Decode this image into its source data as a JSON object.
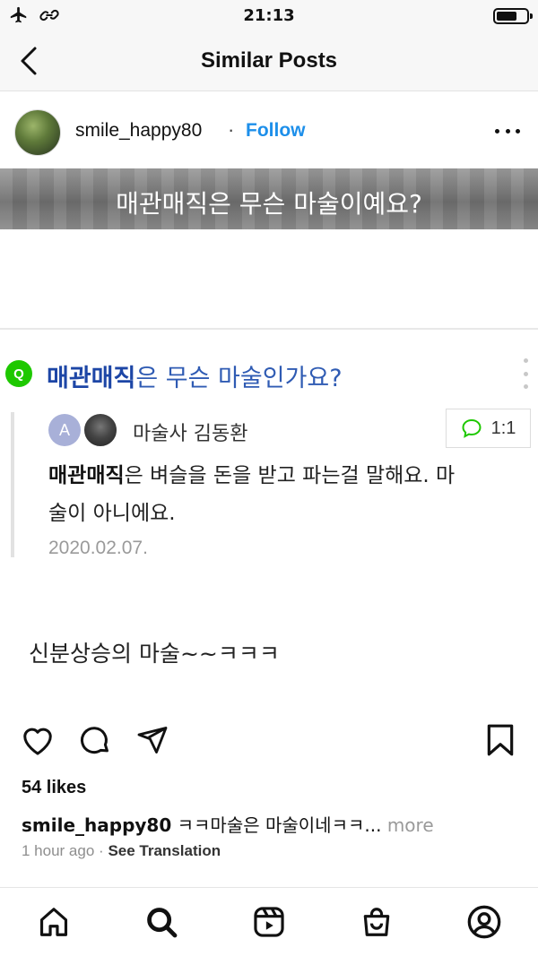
{
  "status_bar": {
    "time": "21:13"
  },
  "header": {
    "title": "Similar Posts"
  },
  "post": {
    "username": "smile_happy80",
    "separator": "·",
    "follow_label": "Follow",
    "image": {
      "banner_text": "매관매직은 무슨 마술이예요?",
      "question_badge": "Q",
      "question_bold": "매관매직",
      "question_rest": "은 무슨 마술인가요?",
      "answer_avatar_letter": "A",
      "answerer_name": "마술사 김동환",
      "chat_count": "1:1",
      "answer_bold": "매관매직",
      "answer_rest_line1": "은 벼슬을 돈을 받고 파는걸 말해요. 마",
      "answer_line2": "술이 아니에요.",
      "answer_date": "2020.02.07."
    },
    "caption_overlay": "신분상승의 마술~~ㅋㅋㅋ",
    "likes": "54 likes",
    "caption_username": "smile_happy80",
    "caption_text": "ㅋㅋ마술은 마술이네ㅋㅋ...",
    "more_label": "more",
    "time_ago": "1 hour ago",
    "meta_sep": "·",
    "see_translation": "See Translation"
  },
  "icons": {
    "status": [
      "airplane-icon",
      "link-icon",
      "battery-icon"
    ],
    "actions": [
      "heart-icon",
      "comment-icon",
      "send-icon",
      "bookmark-icon"
    ],
    "nav": [
      "home-icon",
      "search-icon",
      "reels-icon",
      "shop-icon",
      "profile-icon"
    ]
  }
}
